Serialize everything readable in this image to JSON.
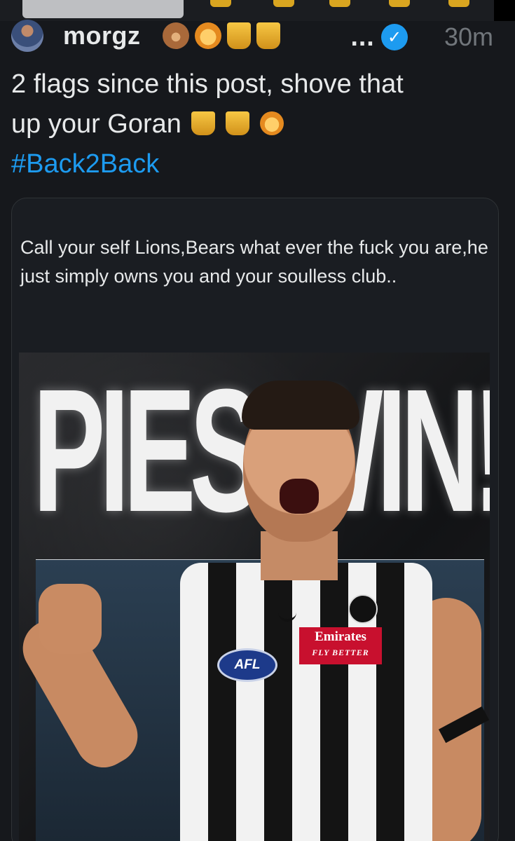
{
  "tweet": {
    "author": {
      "display_name": "morgz",
      "name_emojis": [
        "bear-emoji",
        "lion-emoji",
        "trophy-emoji",
        "trophy-emoji"
      ],
      "name_overflow": "...",
      "verified": true
    },
    "timestamp": "30m",
    "text_line1": "2 flags since this post, shove that",
    "text_line2": "up your Goran",
    "text_line2_emojis": [
      "trophy-emoji",
      "trophy-emoji",
      "lion-emoji"
    ],
    "hashtag": "#Back2Back"
  },
  "quoted_tweet": {
    "text": "Call your self Lions,Bears what ever the fuck you are,he just simply owns you and your soulless club..",
    "media": {
      "headline": "PIES WIN!",
      "sponsor_main": "Emirates",
      "sponsor_sub": "FLY BETTER",
      "league_logo": "AFL"
    }
  },
  "colors": {
    "background": "#16181c",
    "text": "#e7e9ea",
    "muted": "#71767b",
    "link": "#1d9bf0",
    "verified": "#1d9bf0"
  }
}
